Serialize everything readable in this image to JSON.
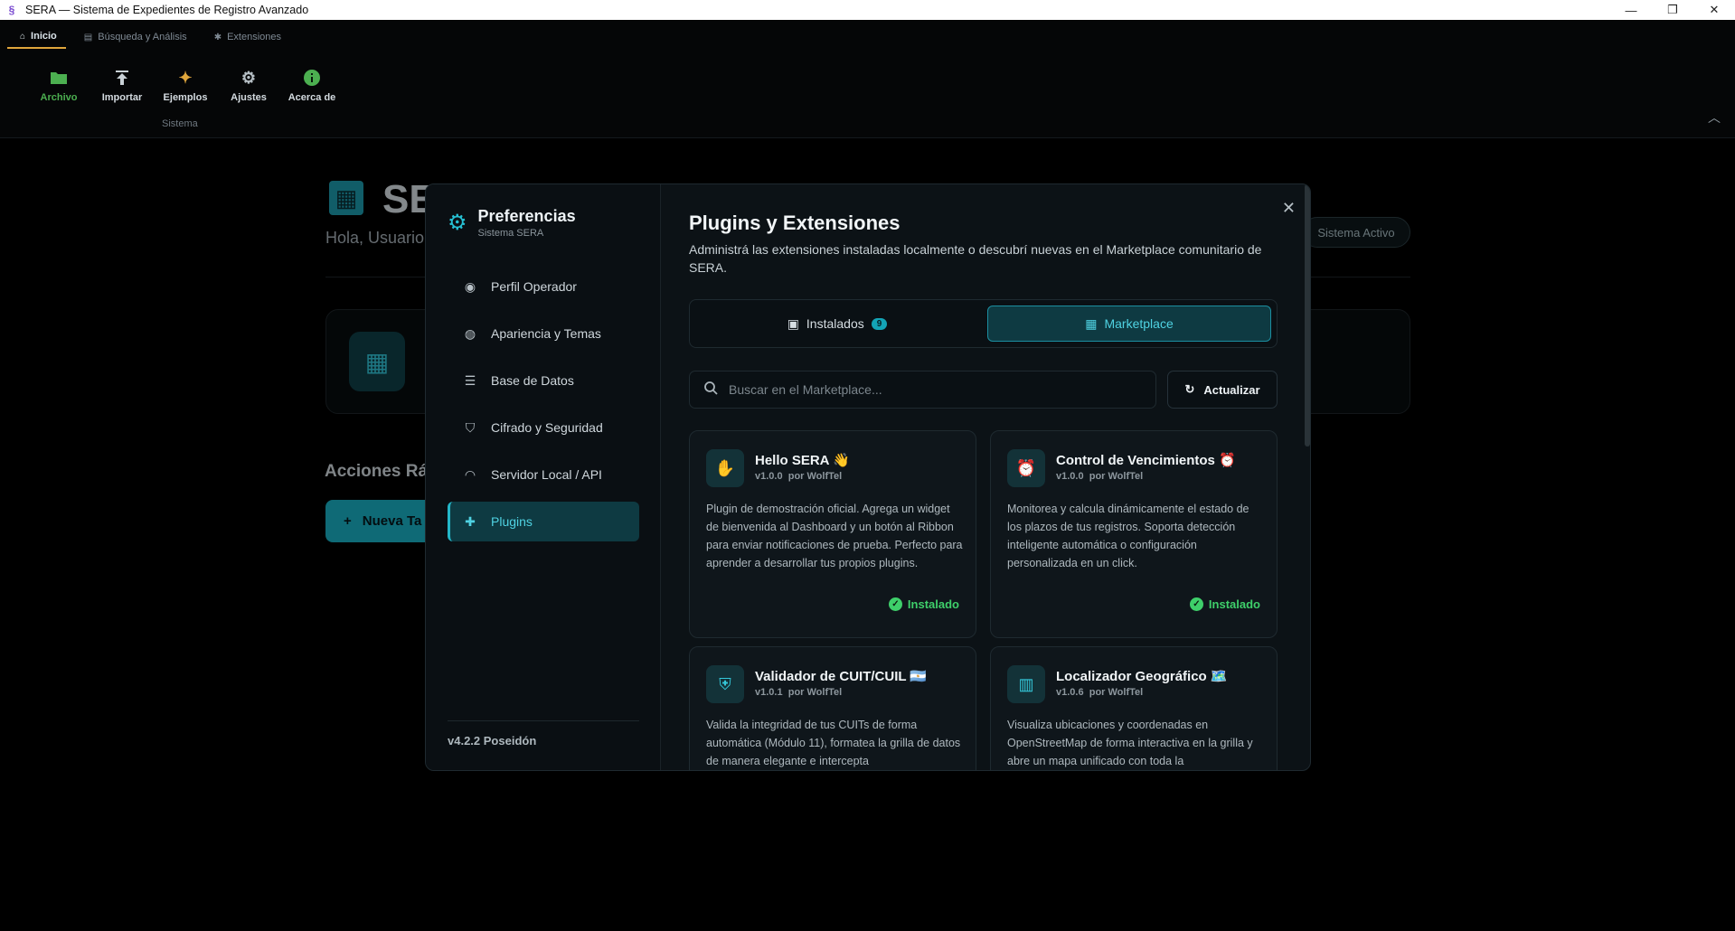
{
  "window": {
    "title": "SERA — Sistema de Expedientes de Registro Avanzado",
    "controls": [
      "—",
      "❐",
      "✕"
    ]
  },
  "ribbon": {
    "tabs": [
      {
        "label": "Inicio",
        "icon": "home-icon"
      },
      {
        "label": "Búsqueda y Análisis",
        "icon": "chart-icon"
      },
      {
        "label": "Extensiones",
        "icon": "puzzle-icon"
      }
    ],
    "buttons": [
      {
        "label": "Archivo",
        "icon": "folder-icon"
      },
      {
        "label": "Importar",
        "icon": "upload-icon"
      },
      {
        "label": "Ejemplos",
        "icon": "sparkles-icon"
      },
      {
        "label": "Ajustes",
        "icon": "gear-icon"
      },
      {
        "label": "Acerca de",
        "icon": "info-icon"
      }
    ],
    "group_label": "Sistema"
  },
  "background": {
    "title": "SE",
    "greeting": "Hola, Usuario",
    "status": "Sistema Activo",
    "quick_actions": "Acciones Ráp",
    "new_button": "Nueva Ta"
  },
  "modal": {
    "sidebar": {
      "title": "Preferencias",
      "subtitle": "Sistema SERA",
      "items": [
        {
          "label": "Perfil Operador",
          "icon": "user-circle-icon"
        },
        {
          "label": "Apariencia y Temas",
          "icon": "palette-icon"
        },
        {
          "label": "Base de Datos",
          "icon": "database-icon"
        },
        {
          "label": "Cifrado y Seguridad",
          "icon": "shield-icon"
        },
        {
          "label": "Servidor Local / API",
          "icon": "broadcast-icon"
        },
        {
          "label": "Plugins",
          "icon": "puzzle-icon"
        }
      ],
      "active_item": "Plugins",
      "version": "v4.2.2 Poseidón"
    },
    "content": {
      "title": "Plugins y Extensiones",
      "description": "Administrá las extensiones instaladas localmente o descubrí nuevas en el Marketplace comunitario de SERA.",
      "tabs": {
        "installed_label": "Instalados",
        "installed_count": "9",
        "marketplace_label": "Marketplace",
        "active": "Marketplace"
      },
      "search_placeholder": "Buscar en el Marketplace...",
      "refresh_label": "Actualizar",
      "plugins": [
        {
          "name": "Hello SERA 👋",
          "version": "v1.0.0",
          "author": "por WolfTel",
          "description": "Plugin de demostración oficial. Agrega un widget de bienvenida al Dashboard y un botón al Ribbon para enviar notificaciones de prueba. Perfecto para aprender a desarrollar tus propios plugins.",
          "status": "Instalado",
          "icon": "wave-hand-icon"
        },
        {
          "name": "Control de Vencimientos ⏰",
          "version": "v1.0.0",
          "author": "por WolfTel",
          "description": "Monitorea y calcula dinámicamente el estado de los plazos de tus registros. Soporta detección inteligente automática o configuración personalizada en un click.",
          "status": "Instalado",
          "icon": "alarm-clock-icon"
        },
        {
          "name": "Validador de CUIT/CUIL 🇦🇷",
          "version": "v1.0.1",
          "author": "por WolfTel",
          "description": "Valida la integridad de tus CUITs de forma automática (Módulo 11), formatea la grilla de datos de manera elegante e intercepta",
          "status": "",
          "icon": "shield-check-icon"
        },
        {
          "name": "Localizador Geográfico 🗺️",
          "version": "v1.0.6",
          "author": "por WolfTel",
          "description": "Visualiza ubicaciones y coordenadas en OpenStreetMap de forma interactiva en la grilla y abre un mapa unificado con toda la",
          "status": "",
          "icon": "map-icon"
        }
      ]
    }
  },
  "colors": {
    "accent": "#23b6c8",
    "success": "#3ecf6a",
    "background": "#000000",
    "modal": "#0c1216"
  }
}
